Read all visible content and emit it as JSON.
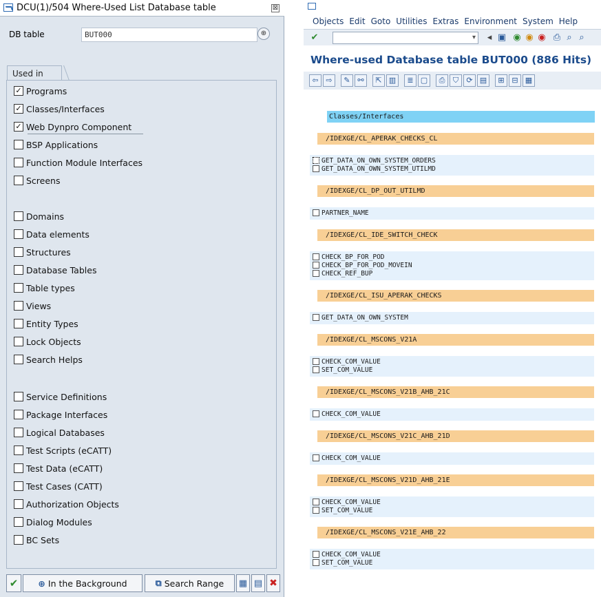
{
  "dialog": {
    "title": "DCU(1)/504 Where-Used List Database table",
    "close_glyph": "⊠",
    "db_table_label": "DB table",
    "db_table_value": "BUT000",
    "used_in_tab": "Used in",
    "options": [
      {
        "label": "Programs",
        "checked": true
      },
      {
        "label": "Classes/Interfaces",
        "checked": true
      },
      {
        "label": "Web Dynpro Component",
        "checked": true
      },
      {
        "label": "BSP Applications",
        "checked": false
      },
      {
        "label": "Function Module Interfaces",
        "checked": false
      },
      {
        "label": "Screens",
        "checked": false
      },
      {
        "label": "Domains",
        "checked": false
      },
      {
        "label": "Data elements",
        "checked": false
      },
      {
        "label": "Structures",
        "checked": false
      },
      {
        "label": "Database Tables",
        "checked": false
      },
      {
        "label": "Table types",
        "checked": false
      },
      {
        "label": "Views",
        "checked": false
      },
      {
        "label": "Entity Types",
        "checked": false
      },
      {
        "label": "Lock Objects",
        "checked": false
      },
      {
        "label": "Search Helps",
        "checked": false
      },
      {
        "label": "Service Definitions",
        "checked": false
      },
      {
        "label": "Package Interfaces",
        "checked": false
      },
      {
        "label": "Logical Databases",
        "checked": false
      },
      {
        "label": "Test Scripts (eCATT)",
        "checked": false
      },
      {
        "label": "Test Data (eCATT)",
        "checked": false
      },
      {
        "label": "Test Cases (CATT)",
        "checked": false
      },
      {
        "label": "Authorization Objects",
        "checked": false
      },
      {
        "label": "Dialog Modules",
        "checked": false
      },
      {
        "label": "BC Sets",
        "checked": false
      }
    ],
    "buttons": {
      "background_label": "In the Background",
      "search_range_label": "Search Range"
    }
  },
  "sap": {
    "menu": [
      "Objects",
      "Edit",
      "Goto",
      "Utilities",
      "Extras",
      "Environment",
      "System",
      "Help"
    ],
    "title": "Where-used Database table BUT000 (886 Hits)",
    "list": {
      "section_header": "Classes/Interfaces",
      "classes": [
        {
          "name": "/IDEXGE/CL_APERAK_CHECKS_CL",
          "methods": [
            "GET_DATA_ON_OWN_SYSTEM_ORDERS",
            "GET_DATA_ON_OWN_SYSTEM_UTILMD"
          ]
        },
        {
          "name": "/IDEXGE/CL_DP_OUT_UTILMD",
          "methods": [
            "PARTNER_NAME"
          ]
        },
        {
          "name": "/IDEXGE/CL_IDE_SWITCH_CHECK",
          "methods": [
            "CHECK_BP_FOR_POD",
            "CHECK_BP_FOR_POD_MOVEIN",
            "CHECK_REF_BUP"
          ]
        },
        {
          "name": "/IDEXGE/CL_ISU_APERAK_CHECKS",
          "methods": [
            "GET_DATA_ON_OWN_SYSTEM"
          ]
        },
        {
          "name": "/IDEXGE/CL_MSCONS_V21A",
          "methods": [
            "CHECK_COM_VALUE",
            "SET_COM_VALUE"
          ]
        },
        {
          "name": "/IDEXGE/CL_MSCONS_V21B_AHB_21C",
          "methods": [
            "CHECK_COM_VALUE"
          ]
        },
        {
          "name": "/IDEXGE/CL_MSCONS_V21C_AHB_21D",
          "methods": [
            "CHECK_COM_VALUE"
          ]
        },
        {
          "name": "/IDEXGE/CL_MSCONS_V21D_AHB_21E",
          "methods": [
            "CHECK_COM_VALUE",
            "SET_COM_VALUE"
          ]
        },
        {
          "name": "/IDEXGE/CL_MSCONS_V21E_AHB_22",
          "methods": [
            "CHECK_COM_VALUE",
            "SET_COM_VALUE"
          ]
        }
      ]
    }
  },
  "colors": {
    "class_bar": "#f8cf95",
    "section_bar": "#7fd2f5",
    "method_bg": "#e5f1fc",
    "title_blue": "#1b4b8c",
    "panel_bg": "#dfe6ee"
  }
}
